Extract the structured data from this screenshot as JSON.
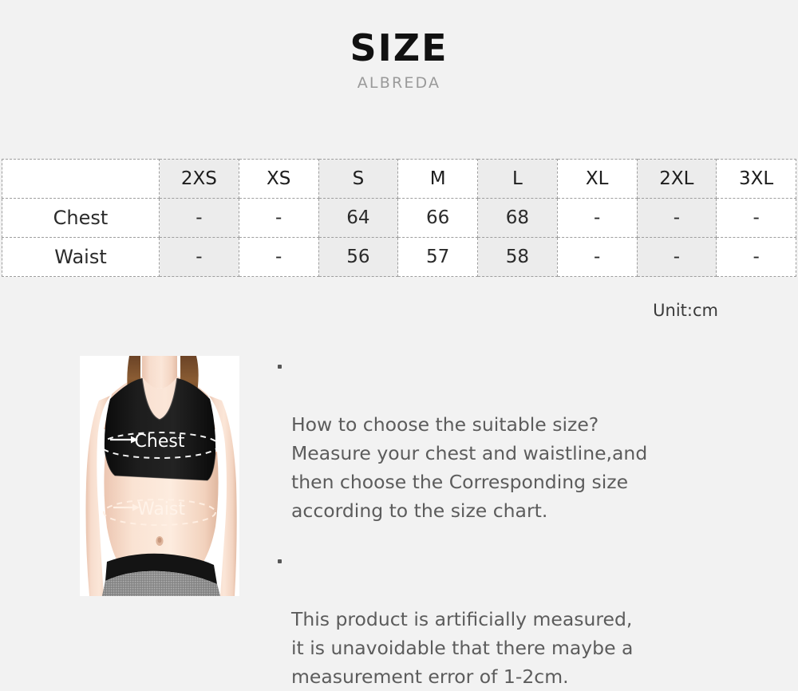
{
  "header": {
    "title": "SIZE",
    "subtitle": "ALBREDA"
  },
  "size_table": {
    "corner_label": "",
    "columns": [
      "2XS",
      "XS",
      "S",
      "M",
      "L",
      "XL",
      "2XL",
      "3XL"
    ],
    "rows": [
      {
        "label": "Chest",
        "values": [
          "-",
          "-",
          "64",
          "66",
          "68",
          "-",
          "-",
          "-"
        ]
      },
      {
        "label": "Waist",
        "values": [
          "-",
          "-",
          "56",
          "57",
          "58",
          "-",
          "-",
          "-"
        ]
      }
    ],
    "unit_note": "Unit:cm",
    "shaded_columns": [
      0,
      2,
      4,
      6
    ],
    "shade_color": "#ececec",
    "cell_color": "#ffffff",
    "border_color": "#9e9e9e"
  },
  "photo": {
    "alt": "woman wearing black sports bra with chest and waist measurement lines",
    "chest_label": "Chest",
    "waist_label": "Waist"
  },
  "notes": [
    {
      "id": "how-to-choose",
      "text": "How to choose the suitable size?\nMeasure your chest and waistline,and\nthen choose the  Corresponding size\naccording to the size chart."
    },
    {
      "id": "measurement-tolerance",
      "text": "This product is artificially measured,\nit is unavoidable that there maybe a\nmeasurement error of 1-2cm."
    }
  ],
  "colors": {
    "background": "#f2f2f2",
    "title": "#111111",
    "subtitle": "#9a9a9a",
    "body_text": "#5c5c5c"
  }
}
